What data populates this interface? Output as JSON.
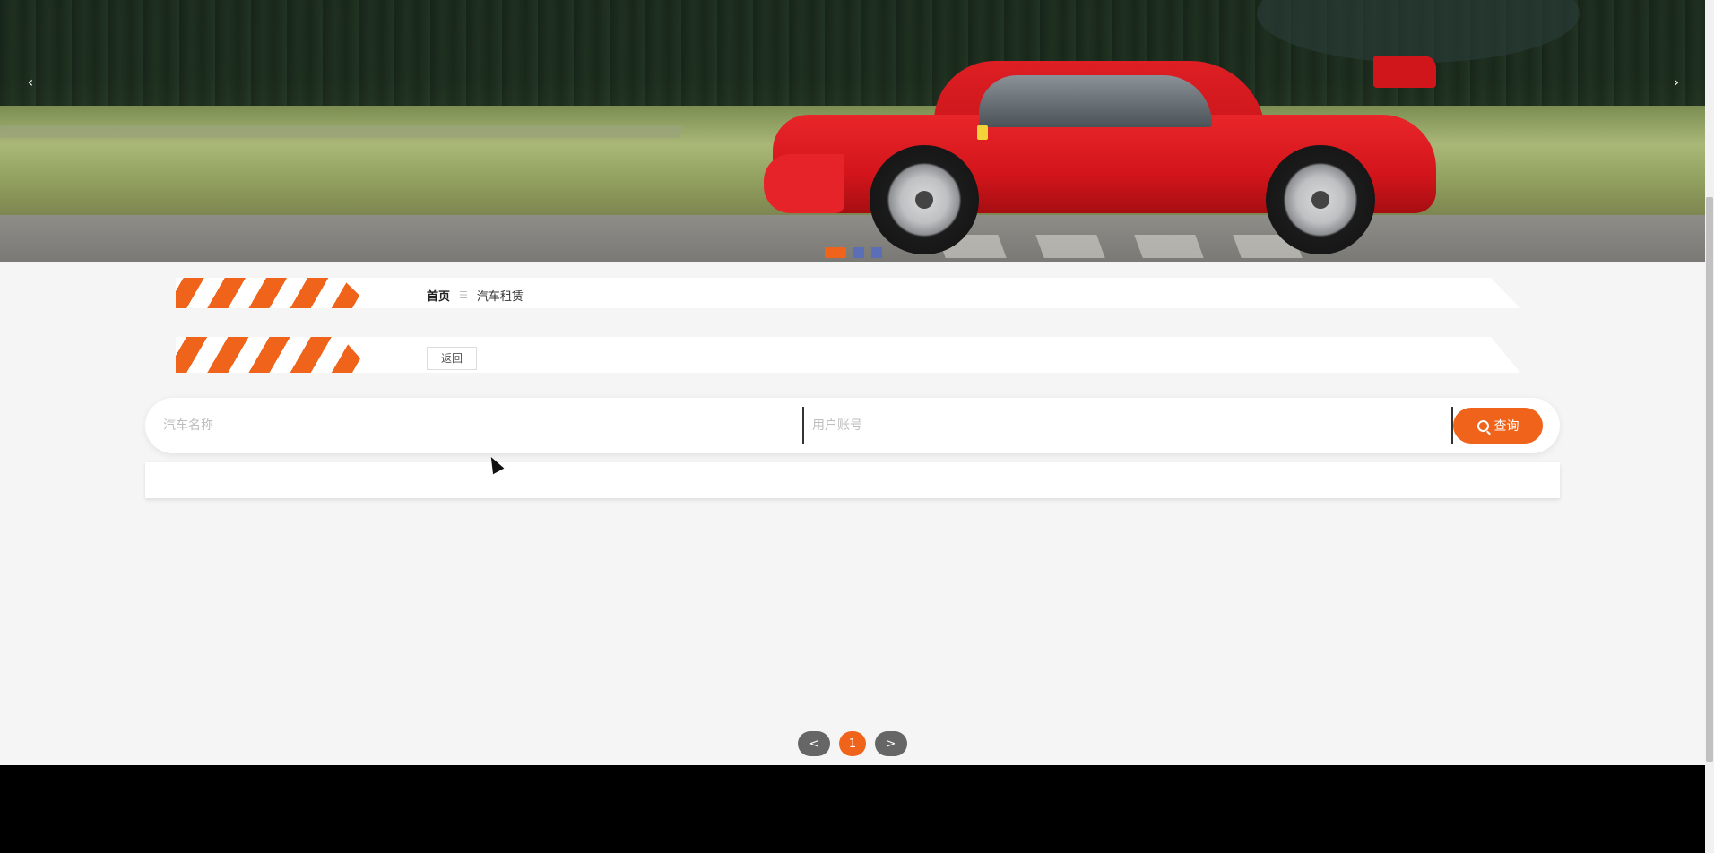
{
  "carousel": {
    "prev_label": "‹",
    "next_label": "›",
    "slides": 3,
    "active_slide": 1,
    "colors": {
      "active_dot": "#f0631b",
      "dot": "#5b6fb8"
    }
  },
  "breadcrumb": {
    "home": "首页",
    "separator": "☰",
    "current": "汽车租赁"
  },
  "actions": {
    "back_label": "返回"
  },
  "search": {
    "field1_placeholder": "汽车名称",
    "field1_value": "",
    "field2_placeholder": "用户账号",
    "field2_value": "",
    "button_label": "查询",
    "button_icon": "search-icon"
  },
  "pagination": {
    "prev_label": "<",
    "current_page": "1",
    "next_label": ">"
  },
  "colors": {
    "accent": "#f0631b",
    "page_bg": "#f5f5f5",
    "footer": "#000000"
  }
}
